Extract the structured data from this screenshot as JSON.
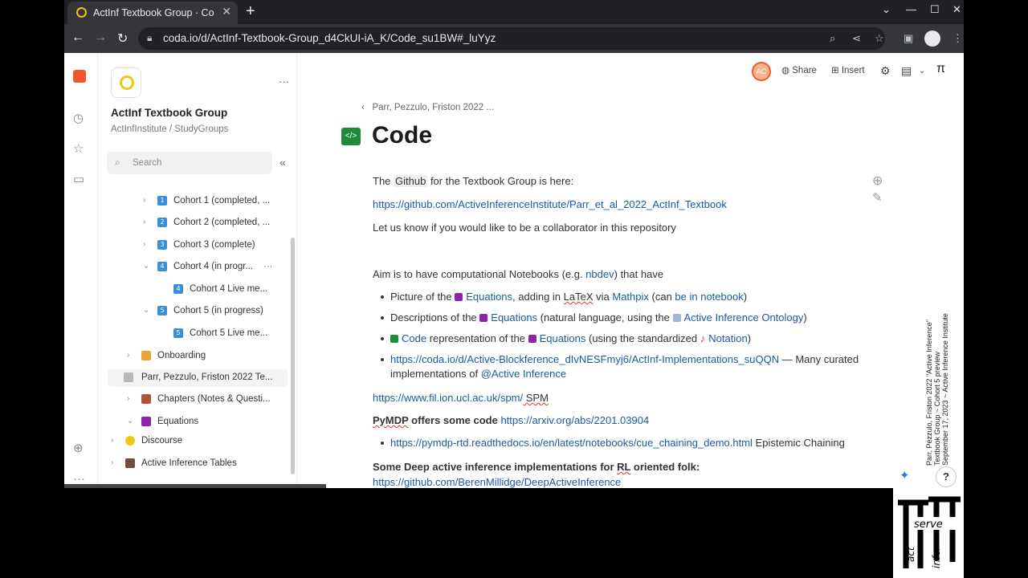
{
  "browser": {
    "tab_title": "ActInf Textbook Group · Cod",
    "tab_close": "✕",
    "new_tab": "+",
    "url": "coda.io/d/ActInf-Textbook-Group_d4CkUI-iA_K/Code_su1BW#_luYyz",
    "window_controls": [
      "⌄",
      "—",
      "☐",
      "✕"
    ]
  },
  "rail": {
    "icons": [
      "coda-logo-icon",
      "clock-icon",
      "star-icon",
      "folder-icon",
      "add-circle-icon",
      "more-icon"
    ]
  },
  "sidebar": {
    "doc_title": "ActInf Textbook Group",
    "doc_subtitle": "ActInfInstitute / StudyGroups",
    "more": "···",
    "search_placeholder": "Search",
    "collapse": "«",
    "items": [
      {
        "label": "Cohort 1 (completed, ...",
        "badge": "1",
        "badge_color": "#3a8fd6",
        "chev": "›"
      },
      {
        "label": "Cohort 2 (completed, ...",
        "badge": "2",
        "badge_color": "#3a8fd6",
        "chev": "›"
      },
      {
        "label": "Cohort 3 (complete)",
        "badge": "3",
        "badge_color": "#3a8fd6",
        "chev": "›"
      },
      {
        "label": "Cohort 4 (in progr...",
        "badge": "4",
        "badge_color": "#3a8fd6",
        "chev": "⌄",
        "more": "···"
      },
      {
        "label": "Cohort 4 Live me...",
        "badge": "4",
        "badge_color": "#3a8fd6"
      },
      {
        "label": "Cohort 5 (in progress)",
        "badge": "5",
        "badge_color": "#3a8fd6",
        "chev": "⌄"
      },
      {
        "label": "Cohort 5 Live me...",
        "badge": "5",
        "badge_color": "#3a8fd6"
      },
      {
        "label": "Onboarding",
        "chev": "›"
      },
      {
        "label": "Parr, Pezzulo, Friston 2022 Te..."
      },
      {
        "label": "Chapters (Notes & Questi...",
        "chev": "›"
      },
      {
        "label": "Equations",
        "chev": "⌄"
      },
      {
        "label": "Discourse",
        "chev": "›"
      },
      {
        "label": "Active Inference Tables",
        "chev": "›"
      }
    ]
  },
  "toolbar": {
    "avatar": "AC",
    "share": "Share",
    "insert": "Insert"
  },
  "main": {
    "breadcrumb": "Parr, Pezzulo, Friston 2022 ...",
    "title": "Code",
    "p1_a": "The ",
    "p1_hl": "Github",
    "p1_b": " for the Textbook Group is here:",
    "link1": "https://github.com/ActiveInferenceInstitute/Parr_et_al_2022_ActInf_Textbook",
    "p2": "Let us know if you would like to be a collaborator in this repository",
    "p3_a": "Aim is to have computational Notebooks (e.g. ",
    "p3_link": "nbdev",
    "p3_b": ") that have",
    "b1_a": "Picture of the ",
    "b1_link": "Equations",
    "b1_b": ", adding in ",
    "b1_latex": "LaTeX",
    "b1_c": " via ",
    "b1_mathpix": "Mathpix",
    "b1_d": " (can ",
    "b1_nb": "be in notebook",
    "b1_e": ")",
    "b2_a": "Descriptions of the ",
    "b2_link": "Equations",
    "b2_b": " (natural language, using the ",
    "b2_onto": "Active Inference Ontology",
    "b2_c": ")",
    "b3_code": "Code",
    "b3_a": " representation of the ",
    "b3_link": "Equations",
    "b3_b": " (using the standardized ",
    "b3_notation": "Notation",
    "b3_c": ")",
    "b4_link": "https://coda.io/d/Active-Blockference_dIvNESFmyj6/ActInf-Implementations_suQQN",
    "b4_a": " — Many curated",
    "b4_b": "implementations of ",
    "b4_link2": "@Active Inference",
    "p4_link": "https://www.fil.ion.ucl.ac.uk/spm/",
    "p4_b": " SPM",
    "p5_bold_a": "PyMDP",
    "p5_bold_b": " offers some code ",
    "p5_link": "https://arxiv.org/abs/2201.03904",
    "b5_link": "https://pymdp-rtd.readthedocs.io/en/latest/notebooks/cue_chaining_demo.html",
    "b5_b": " Epistemic Chaining",
    "p6_bold_a": "Some Deep active inference implementations for ",
    "p6_bold_rl": "RL",
    "p6_bold_b": " oriented folk:",
    "link6": "https://github.com/BerenMillidge/DeepActiveInference"
  },
  "overlay": {
    "line1": "Parr, Pezzulo, Friston 2022 \"Active Inference\"",
    "line2": "Textbook Group ~ Cohort 5 preview",
    "line3": "September 17, 2023 ~ Active Inference Institute",
    "help": "?",
    "logo_words": [
      "serve",
      "act",
      "infer"
    ]
  },
  "colors": {
    "coda_orange": "#ee5a29",
    "link": "#1a5ba6",
    "equations_purple": "#8e24aa",
    "code_green": "#1f8a3a"
  }
}
